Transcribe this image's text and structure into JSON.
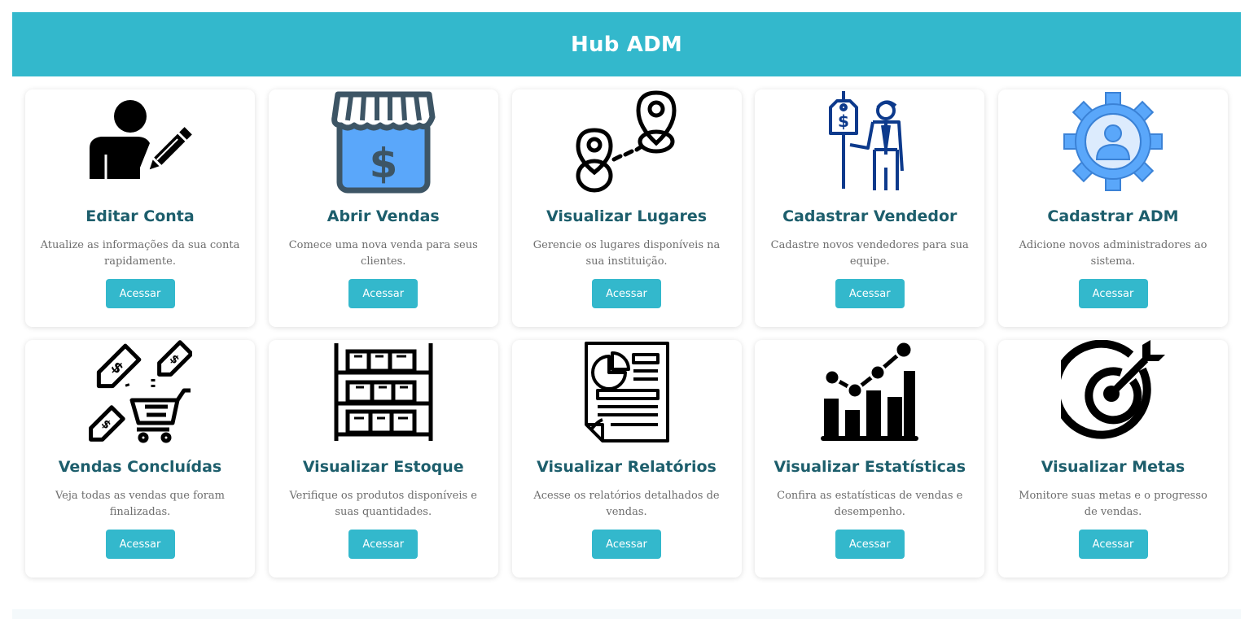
{
  "header": {
    "title": "Hub ADM"
  },
  "cards": [
    {
      "icon": "user-edit-icon",
      "title": "Editar Conta",
      "description": "Atualize as informações da sua conta rapidamente.",
      "button": "Acessar"
    },
    {
      "icon": "store-dollar-icon",
      "title": "Abrir Vendas",
      "description": "Comece uma nova venda para seus clientes.",
      "button": "Acessar"
    },
    {
      "icon": "map-pins-route-icon",
      "title": "Visualizar Lugares",
      "description": "Gerencie os lugares disponíveis na sua instituição.",
      "button": "Acessar"
    },
    {
      "icon": "salesman-price-tag-icon",
      "title": "Cadastrar Vendedor",
      "description": "Cadastre novos vendedores para sua equipe.",
      "button": "Acessar"
    },
    {
      "icon": "admin-gear-icon",
      "title": "Cadastrar ADM",
      "description": "Adicione novos administradores ao sistema.",
      "button": "Acessar"
    },
    {
      "icon": "cart-price-tags-icon",
      "title": "Vendas Concluídas",
      "description": "Veja todas as vendas que foram finalizadas.",
      "button": "Acessar"
    },
    {
      "icon": "stock-shelves-icon",
      "title": "Visualizar Estoque",
      "description": "Verifique os produtos disponíveis e suas quantidades.",
      "button": "Acessar"
    },
    {
      "icon": "report-document-icon",
      "title": "Visualizar Relatórios",
      "description": "Acesse os relatórios detalhados de vendas.",
      "button": "Acessar"
    },
    {
      "icon": "statistics-chart-icon",
      "title": "Visualizar Estatísticas",
      "description": "Confira as estatísticas de vendas e desempenho.",
      "button": "Acessar"
    },
    {
      "icon": "target-goal-icon",
      "title": "Visualizar Metas",
      "description": "Monitore suas metas e o progresso de vendas.",
      "button": "Acessar"
    }
  ],
  "colors": {
    "header_bg": "#33b8cc",
    "title_text": "#1d5e6c",
    "button_bg": "#33b8cc",
    "icon_blue_fill": "#5aa7fa",
    "icon_dark_outline": "#3d5565",
    "icon_navy": "#0d3a8c"
  }
}
